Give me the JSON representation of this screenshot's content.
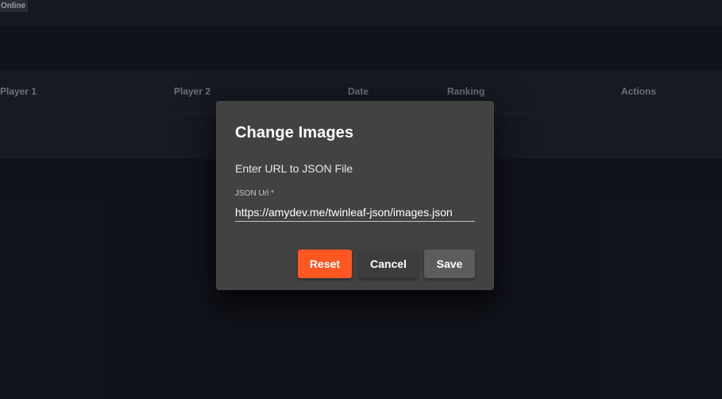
{
  "status": {
    "label": "Online"
  },
  "table": {
    "columns": [
      "Player 1",
      "Player 2",
      "Date",
      "Ranking",
      "Actions"
    ]
  },
  "dialog": {
    "title": "Change Images",
    "text": "Enter URL to JSON File",
    "field": {
      "label": "JSON Url *",
      "value": "https://amydev.me/twinleaf-json/images.json"
    },
    "buttons": {
      "reset": "Reset",
      "cancel": "Cancel",
      "save": "Save"
    }
  },
  "colors": {
    "accent": "#ff5722",
    "dialog_bg": "#424242",
    "page_bg": "#161a22"
  }
}
